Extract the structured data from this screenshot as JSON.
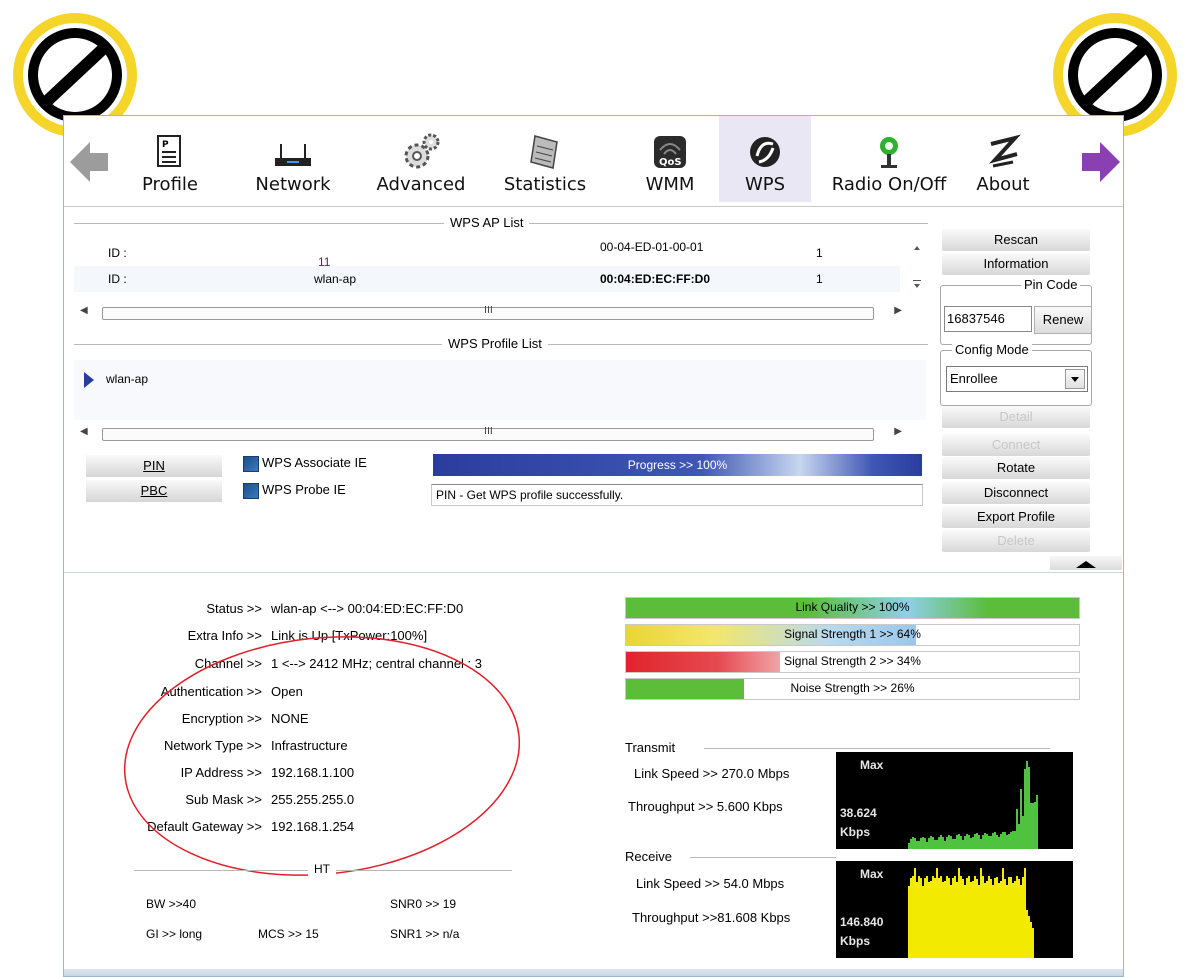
{
  "toolbar": {
    "items": [
      {
        "label": "Profile",
        "icon": "profile-icon"
      },
      {
        "label": "Network",
        "icon": "network-icon"
      },
      {
        "label": "Advanced",
        "icon": "advanced-icon"
      },
      {
        "label": "Statistics",
        "icon": "statistics-icon"
      },
      {
        "label": "WMM",
        "icon": "wmm-icon"
      },
      {
        "label": "WPS",
        "icon": "wps-icon",
        "active": true
      },
      {
        "label": "Radio On/Off",
        "icon": "radio-icon"
      },
      {
        "label": "About",
        "icon": "about-icon"
      }
    ],
    "wmm_badge": "QoS"
  },
  "wps_ap_list": {
    "title": "WPS AP List",
    "rows": [
      {
        "id_label": "ID :",
        "name": "11",
        "bssid": "00-04-ED-01-00-01",
        "channel": "1"
      },
      {
        "id_label": "ID :",
        "name": "wlan-ap",
        "bssid": "00:04:ED:EC:FF:D0",
        "channel": "1"
      }
    ]
  },
  "wps_profile_list": {
    "title": "WPS Profile List",
    "items": [
      "wlan-ap"
    ]
  },
  "scroll_grip": "III",
  "right_panel": {
    "rescan": "Rescan",
    "information": "Information",
    "pin_code_title": "Pin Code",
    "pin_code": "16837546",
    "renew": "Renew",
    "config_mode_title": "Config Mode",
    "config_mode": "Enrollee",
    "detail": "Detail",
    "connect": "Connect",
    "rotate": "Rotate",
    "disconnect": "Disconnect",
    "export_profile": "Export Profile",
    "delete": "Delete"
  },
  "wps_actions": {
    "pin": "PIN",
    "pbc": "PBC",
    "associate_ie": "WPS Associate IE",
    "probe_ie": "WPS Probe IE",
    "progress_text": "Progress >> 100%",
    "progress": 100,
    "status_msg": "PIN - Get WPS profile successfully."
  },
  "status": {
    "rows": [
      {
        "label": "Status >>",
        "value": "wlan-ap  <-->  00:04:ED:EC:FF:D0"
      },
      {
        "label": "Extra Info >>",
        "value": "Link is Up [TxPower:100%]"
      },
      {
        "label": "Channel >>",
        "value": "1 <--> 2412 MHz; central channel : 3"
      },
      {
        "label": "Authentication >>",
        "value": "Open"
      },
      {
        "label": "Encryption >>",
        "value": "NONE"
      },
      {
        "label": "Network Type >>",
        "value": "Infrastructure"
      },
      {
        "label": "IP Address >>",
        "value": "192.168.1.100"
      },
      {
        "label": "Sub Mask >>",
        "value": "255.255.255.0"
      },
      {
        "label": "Default Gateway >>",
        "value": "192.168.1.254"
      }
    ],
    "ht_title": "HT",
    "bw": "BW >>40",
    "gi": "GI >> long",
    "mcs": "MCS >>  15",
    "snr0": "SNR0 >>  19",
    "snr1": "SNR1 >>  n/a"
  },
  "signal": {
    "link_quality": {
      "text": "Link Quality >> 100%",
      "value": 100
    },
    "signal1": {
      "text": "Signal Strength 1 >> 64%",
      "value": 64
    },
    "signal2": {
      "text": "Signal Strength 2 >> 34%",
      "value": 34
    },
    "noise": {
      "text": "Noise Strength >> 26%",
      "value": 26
    }
  },
  "transmit": {
    "title": "Transmit",
    "link_speed": "Link Speed >> 270.0 Mbps",
    "throughput": "Throughput >> 5.600 Kbps",
    "graph_max": "Max",
    "graph_value": "38.624",
    "graph_unit": "Kbps",
    "graph_color": "#4fc23f"
  },
  "receive": {
    "title": "Receive",
    "link_speed": "Link Speed >> 54.0 Mbps",
    "throughput": "Throughput >>81.608 Kbps",
    "graph_max": "Max",
    "graph_value": "146.840",
    "graph_unit": "Kbps",
    "graph_color": "#f2ea00"
  },
  "colors": {
    "accent_blue": "#2a3d9c",
    "highlight_red": "#e0202a",
    "stamp_yellow": "#f6d52a"
  }
}
